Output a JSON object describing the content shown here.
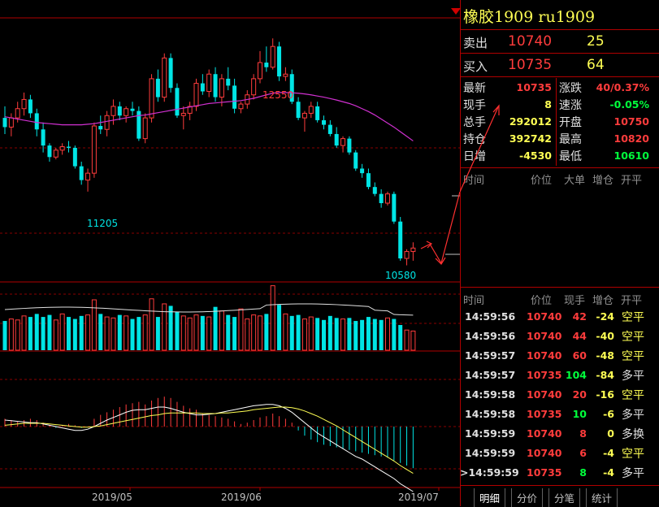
{
  "colors": {
    "up": "#ff3c3c",
    "down": "#00e5e5",
    "ma": "#d030d0",
    "grid": "#b00000"
  },
  "header": {
    "title": "橡胶1909  ru1909"
  },
  "quote": {
    "sell": {
      "label": "卖出",
      "price": "10740",
      "volume": "25"
    },
    "buy": {
      "label": "买入",
      "price": "10735",
      "volume": "64"
    }
  },
  "stats": [
    {
      "l1": "最新",
      "v1": "10735",
      "c1": "red",
      "l2": "涨跌",
      "v2": "40/0.37%",
      "c2": "red"
    },
    {
      "l1": "现手",
      "v1": "8",
      "c1": "yel",
      "l2": "速涨",
      "v2": "-0.05%",
      "c2": "grn"
    },
    {
      "l1": "总手",
      "v1": "292012",
      "c1": "yel",
      "l2": "开盘",
      "v2": "10750",
      "c2": "red"
    },
    {
      "l1": "持仓",
      "v1": "392742",
      "c1": "yel",
      "l2": "最高",
      "v2": "10820",
      "c2": "red"
    },
    {
      "l1": "日增",
      "v1": "-4530",
      "c1": "yel",
      "l2": "最低",
      "v2": "10610",
      "c2": "grn"
    }
  ],
  "big_order_header": [
    "时间",
    "价位",
    "大单",
    "增仓",
    "开平"
  ],
  "trade_header": [
    "时间",
    "价位",
    "现手",
    "增仓",
    "开平"
  ],
  "trades": [
    {
      "time": "14:59:56",
      "price": "10740",
      "pc": "red",
      "vol": "42",
      "vc": "red",
      "oi": "-24",
      "type": "空平",
      "tc": "yel"
    },
    {
      "time": "14:59:56",
      "price": "10740",
      "pc": "red",
      "vol": "44",
      "vc": "red",
      "oi": "-40",
      "type": "空平",
      "tc": "yel"
    },
    {
      "time": "14:59:57",
      "price": "10740",
      "pc": "red",
      "vol": "60",
      "vc": "red",
      "oi": "-48",
      "type": "空平",
      "tc": "yel"
    },
    {
      "time": "14:59:57",
      "price": "10735",
      "pc": "red",
      "vol": "104",
      "vc": "grn",
      "oi": "-84",
      "type": "多平",
      "tc": "wht"
    },
    {
      "time": "14:59:58",
      "price": "10740",
      "pc": "red",
      "vol": "20",
      "vc": "red",
      "oi": "-16",
      "type": "空平",
      "tc": "yel"
    },
    {
      "time": "14:59:58",
      "price": "10735",
      "pc": "red",
      "vol": "10",
      "vc": "grn",
      "oi": "-6",
      "type": "多平",
      "tc": "wht"
    },
    {
      "time": "14:59:59",
      "price": "10740",
      "pc": "red",
      "vol": "8",
      "vc": "red",
      "oi": "0",
      "type": "多换",
      "tc": "wht"
    },
    {
      "time": "14:59:59",
      "price": "10740",
      "pc": "red",
      "vol": "6",
      "vc": "red",
      "oi": "-4",
      "type": "空平",
      "tc": "yel"
    },
    {
      "time": ">14:59:59",
      "price": "10735",
      "pc": "red",
      "vol": "8",
      "vc": "grn",
      "oi": "-4",
      "type": "多平",
      "tc": "wht"
    }
  ],
  "tabs": [
    "明细",
    "分价",
    "分笔",
    "统计"
  ],
  "chart_data": {
    "type": "candlestick",
    "price_labels": {
      "high": "12550",
      "low1": "11205",
      "low2": "10580"
    },
    "xaxis_labels": [
      "2019/05",
      "2019/06",
      "2019/07"
    ],
    "candles": [
      [
        11860,
        11960,
        11720,
        11780
      ],
      [
        11780,
        11900,
        11700,
        11860
      ],
      [
        11860,
        12000,
        11820,
        11940
      ],
      [
        11940,
        12080,
        11880,
        12020
      ],
      [
        12020,
        12060,
        11860,
        11900
      ],
      [
        11900,
        11940,
        11700,
        11760
      ],
      [
        11760,
        11820,
        11560,
        11620
      ],
      [
        11620,
        11640,
        11480,
        11520
      ],
      [
        11520,
        11600,
        11500,
        11580
      ],
      [
        11580,
        11640,
        11540,
        11610
      ],
      [
        11610,
        11660,
        11560,
        11600
      ],
      [
        11600,
        11620,
        11420,
        11440
      ],
      [
        11440,
        11480,
        11280,
        11320
      ],
      [
        11320,
        11420,
        11220,
        11380
      ],
      [
        11380,
        11820,
        11340,
        11790
      ],
      [
        11790,
        11880,
        11720,
        11760
      ],
      [
        11760,
        11920,
        11700,
        11880
      ],
      [
        11880,
        12020,
        11800,
        11960
      ],
      [
        11960,
        12000,
        11840,
        11880
      ],
      [
        11880,
        11960,
        11820,
        11940
      ],
      [
        11940,
        12000,
        11880,
        11920
      ],
      [
        11920,
        11960,
        11660,
        11680
      ],
      [
        11680,
        11900,
        11640,
        11860
      ],
      [
        11860,
        12240,
        11820,
        12200
      ],
      [
        12200,
        12280,
        12000,
        12040
      ],
      [
        12040,
        12420,
        12000,
        12380
      ],
      [
        12380,
        12420,
        12080,
        12120
      ],
      [
        12120,
        12160,
        11860,
        11880
      ],
      [
        11880,
        11960,
        11760,
        11900
      ],
      [
        11900,
        12000,
        11840,
        11960
      ],
      [
        11960,
        12200,
        11920,
        12160
      ],
      [
        12160,
        12240,
        12060,
        12090
      ],
      [
        12090,
        12280,
        12040,
        12240
      ],
      [
        12240,
        12300,
        12000,
        12040
      ],
      [
        12040,
        12240,
        11960,
        12200
      ],
      [
        12200,
        12300,
        12100,
        12140
      ],
      [
        12140,
        12200,
        11900,
        11940
      ],
      [
        11940,
        12000,
        11900,
        11980
      ],
      [
        11980,
        12100,
        11940,
        12060
      ],
      [
        12060,
        12240,
        12020,
        12200
      ],
      [
        12200,
        12440,
        12160,
        12340
      ],
      [
        12340,
        12480,
        12260,
        12300
      ],
      [
        12300,
        12550,
        12280,
        12480
      ],
      [
        12480,
        12520,
        12180,
        12220
      ],
      [
        12220,
        12300,
        12180,
        12240
      ],
      [
        12240,
        12280,
        11980,
        12000
      ],
      [
        12000,
        12040,
        11840,
        11860
      ],
      [
        11860,
        11920,
        11740,
        11900
      ],
      [
        11900,
        12000,
        11860,
        11960
      ],
      [
        11960,
        12000,
        11820,
        11840
      ],
      [
        11840,
        11880,
        11760,
        11800
      ],
      [
        11800,
        11840,
        11700,
        11720
      ],
      [
        11720,
        11780,
        11600,
        11620
      ],
      [
        11620,
        11700,
        11560,
        11680
      ],
      [
        11680,
        11700,
        11540,
        11560
      ],
      [
        11560,
        11580,
        11400,
        11420
      ],
      [
        11420,
        11460,
        11340,
        11380
      ],
      [
        11380,
        11420,
        11240,
        11260
      ],
      [
        11260,
        11300,
        11180,
        11200
      ],
      [
        11200,
        11240,
        11080,
        11120
      ],
      [
        11120,
        11220,
        11100,
        11200
      ],
      [
        11200,
        11220,
        10940,
        10960
      ],
      [
        10960,
        11000,
        10620,
        10640
      ],
      [
        10640,
        10720,
        10580,
        10700
      ],
      [
        10700,
        10780,
        10620,
        10730
      ]
    ],
    "ma": [
      11870,
      11860,
      11850,
      11840,
      11830,
      11820,
      11815,
      11810,
      11805,
      11800,
      11800,
      11800,
      11800,
      11805,
      11810,
      11820,
      11830,
      11840,
      11850,
      11860,
      11870,
      11880,
      11885,
      11895,
      11905,
      11915,
      11925,
      11935,
      11945,
      11955,
      11965,
      11975,
      11985,
      11990,
      11995,
      12000,
      12005,
      12010,
      12020,
      12030,
      12045,
      12060,
      12075,
      12080,
      12080,
      12078,
      12074,
      12068,
      12060,
      12050,
      12040,
      12028,
      12015,
      12000,
      11985,
      11965,
      11940,
      11915,
      11885,
      11850,
      11815,
      11780,
      11740,
      11700,
      11660
    ],
    "volume": [
      0.58,
      0.62,
      0.6,
      0.68,
      0.66,
      0.72,
      0.66,
      0.7,
      0.6,
      0.72,
      0.66,
      0.62,
      0.68,
      0.7,
      1.0,
      0.72,
      0.66,
      0.64,
      0.7,
      0.68,
      0.62,
      0.66,
      0.7,
      1.02,
      0.66,
      0.92,
      0.88,
      0.76,
      0.68,
      0.64,
      0.7,
      0.68,
      0.66,
      0.86,
      0.78,
      0.7,
      0.66,
      0.82,
      0.62,
      0.7,
      0.68,
      0.72,
      1.28,
      0.9,
      0.72,
      0.68,
      0.7,
      0.62,
      0.66,
      0.64,
      0.6,
      0.68,
      0.64,
      0.62,
      0.64,
      0.58,
      0.6,
      0.66,
      0.62,
      0.6,
      0.64,
      0.62,
      0.5,
      0.4,
      0.38
    ],
    "macd": {
      "hist": [
        0.12,
        0.1,
        0.08,
        0.1,
        0.12,
        0.1,
        0.06,
        0.02,
        -0.02,
        0.02,
        0.04,
        0.02,
        -0.02,
        0.0,
        0.12,
        0.18,
        0.22,
        0.26,
        0.3,
        0.34,
        0.36,
        0.38,
        0.34,
        0.4,
        0.44,
        0.46,
        0.44,
        0.38,
        0.32,
        0.28,
        0.26,
        0.2,
        0.18,
        0.16,
        0.14,
        0.12,
        0.08,
        0.04,
        0.06,
        0.1,
        0.14,
        0.16,
        0.2,
        0.16,
        0.12,
        0.06,
        -0.06,
        -0.14,
        -0.2,
        -0.24,
        -0.28,
        -0.3,
        -0.32,
        -0.34,
        -0.36,
        -0.38,
        -0.4,
        -0.42,
        -0.44,
        -0.46,
        -0.48,
        -0.52,
        -0.56,
        -0.6,
        -0.64
      ],
      "dif": [
        0.1,
        0.09,
        0.08,
        0.07,
        0.06,
        0.06,
        0.04,
        0.02,
        0.0,
        -0.02,
        -0.04,
        -0.06,
        -0.06,
        -0.04,
        0.0,
        0.05,
        0.1,
        0.14,
        0.18,
        0.22,
        0.25,
        0.26,
        0.26,
        0.28,
        0.3,
        0.3,
        0.28,
        0.25,
        0.22,
        0.2,
        0.18,
        0.18,
        0.19,
        0.2,
        0.22,
        0.24,
        0.26,
        0.28,
        0.3,
        0.32,
        0.33,
        0.34,
        0.34,
        0.32,
        0.28,
        0.22,
        0.14,
        0.06,
        -0.02,
        -0.1,
        -0.16,
        -0.22,
        -0.28,
        -0.34,
        -0.4,
        -0.46,
        -0.5,
        -0.56,
        -0.62,
        -0.68,
        -0.74,
        -0.8,
        -0.88,
        -0.94,
        -1.0
      ],
      "dea": [
        0.02,
        0.03,
        0.04,
        0.05,
        0.05,
        0.05,
        0.05,
        0.04,
        0.03,
        0.02,
        0.01,
        0.0,
        -0.01,
        -0.01,
        0.0,
        0.01,
        0.03,
        0.05,
        0.07,
        0.09,
        0.11,
        0.13,
        0.15,
        0.17,
        0.18,
        0.2,
        0.21,
        0.21,
        0.21,
        0.21,
        0.21,
        0.2,
        0.2,
        0.2,
        0.21,
        0.21,
        0.22,
        0.23,
        0.24,
        0.26,
        0.27,
        0.28,
        0.29,
        0.3,
        0.3,
        0.29,
        0.27,
        0.24,
        0.2,
        0.16,
        0.11,
        0.06,
        0.01,
        -0.05,
        -0.11,
        -0.17,
        -0.23,
        -0.29,
        -0.35,
        -0.41,
        -0.47,
        -0.53,
        -0.6,
        -0.66,
        -0.72
      ]
    }
  }
}
